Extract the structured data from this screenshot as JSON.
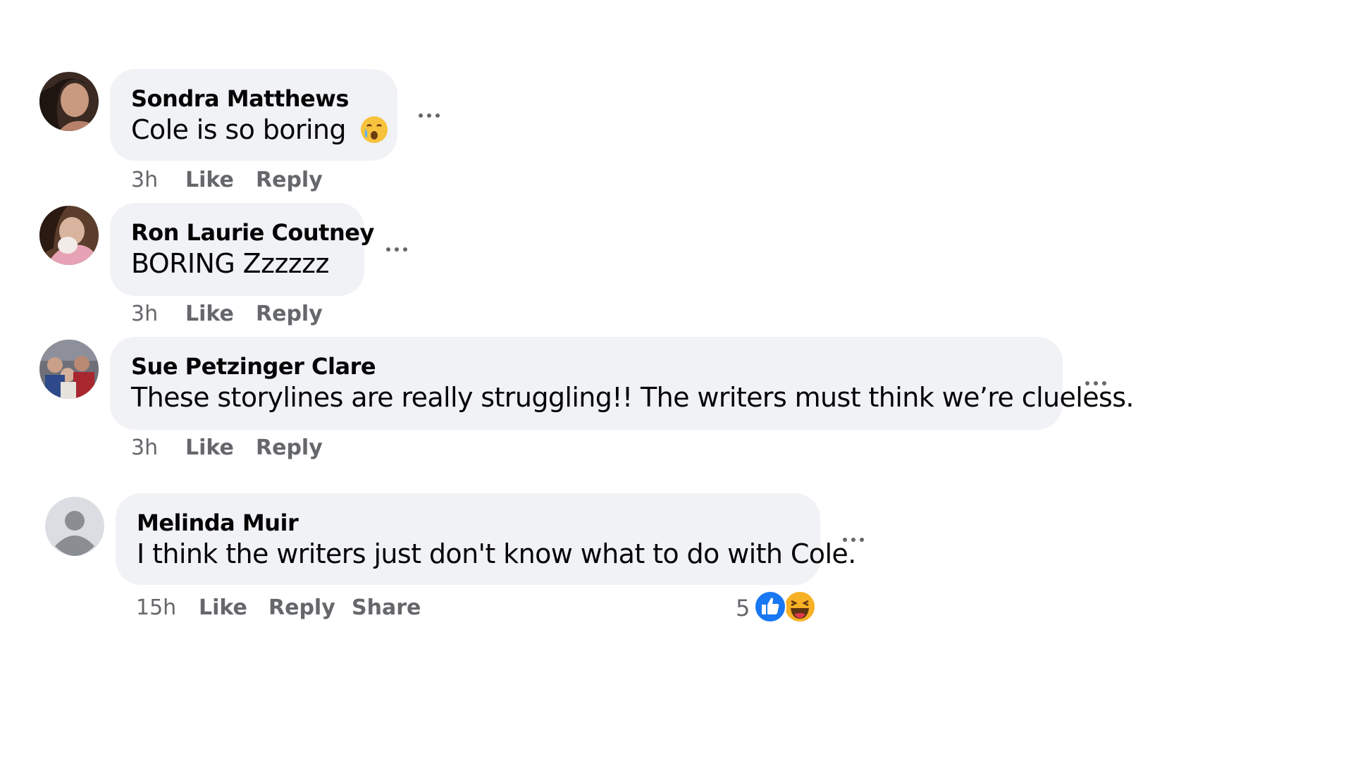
{
  "comments": [
    {
      "author": "Sondra Matthews",
      "text": "Cole is so boring",
      "text_emoji": "crying-face-emoji",
      "time": "3h",
      "like": "Like",
      "reply": "Reply"
    },
    {
      "author": "Ron Laurie Coutney",
      "text": "BORING Zzzzzz",
      "time": "3h",
      "like": "Like",
      "reply": "Reply"
    },
    {
      "author": "Sue Petzinger Clare",
      "text": "These storylines are really struggling!! The writers must think we’re clueless.",
      "time": "3h",
      "like": "Like",
      "reply": "Reply"
    },
    {
      "author": "Melinda Muir",
      "text": "I think the writers just don't know what to do with Cole.",
      "time": "15h",
      "like": "Like",
      "reply": "Reply",
      "share": "Share",
      "reaction_count": "5",
      "reactions": [
        "like-reaction-icon",
        "haha-reaction-icon"
      ]
    }
  ],
  "colors": {
    "bubble": "#f0f2f5",
    "meta_text": "#65676b",
    "like_blue": "#1877f2",
    "haha_yellow": "#f7b125"
  }
}
